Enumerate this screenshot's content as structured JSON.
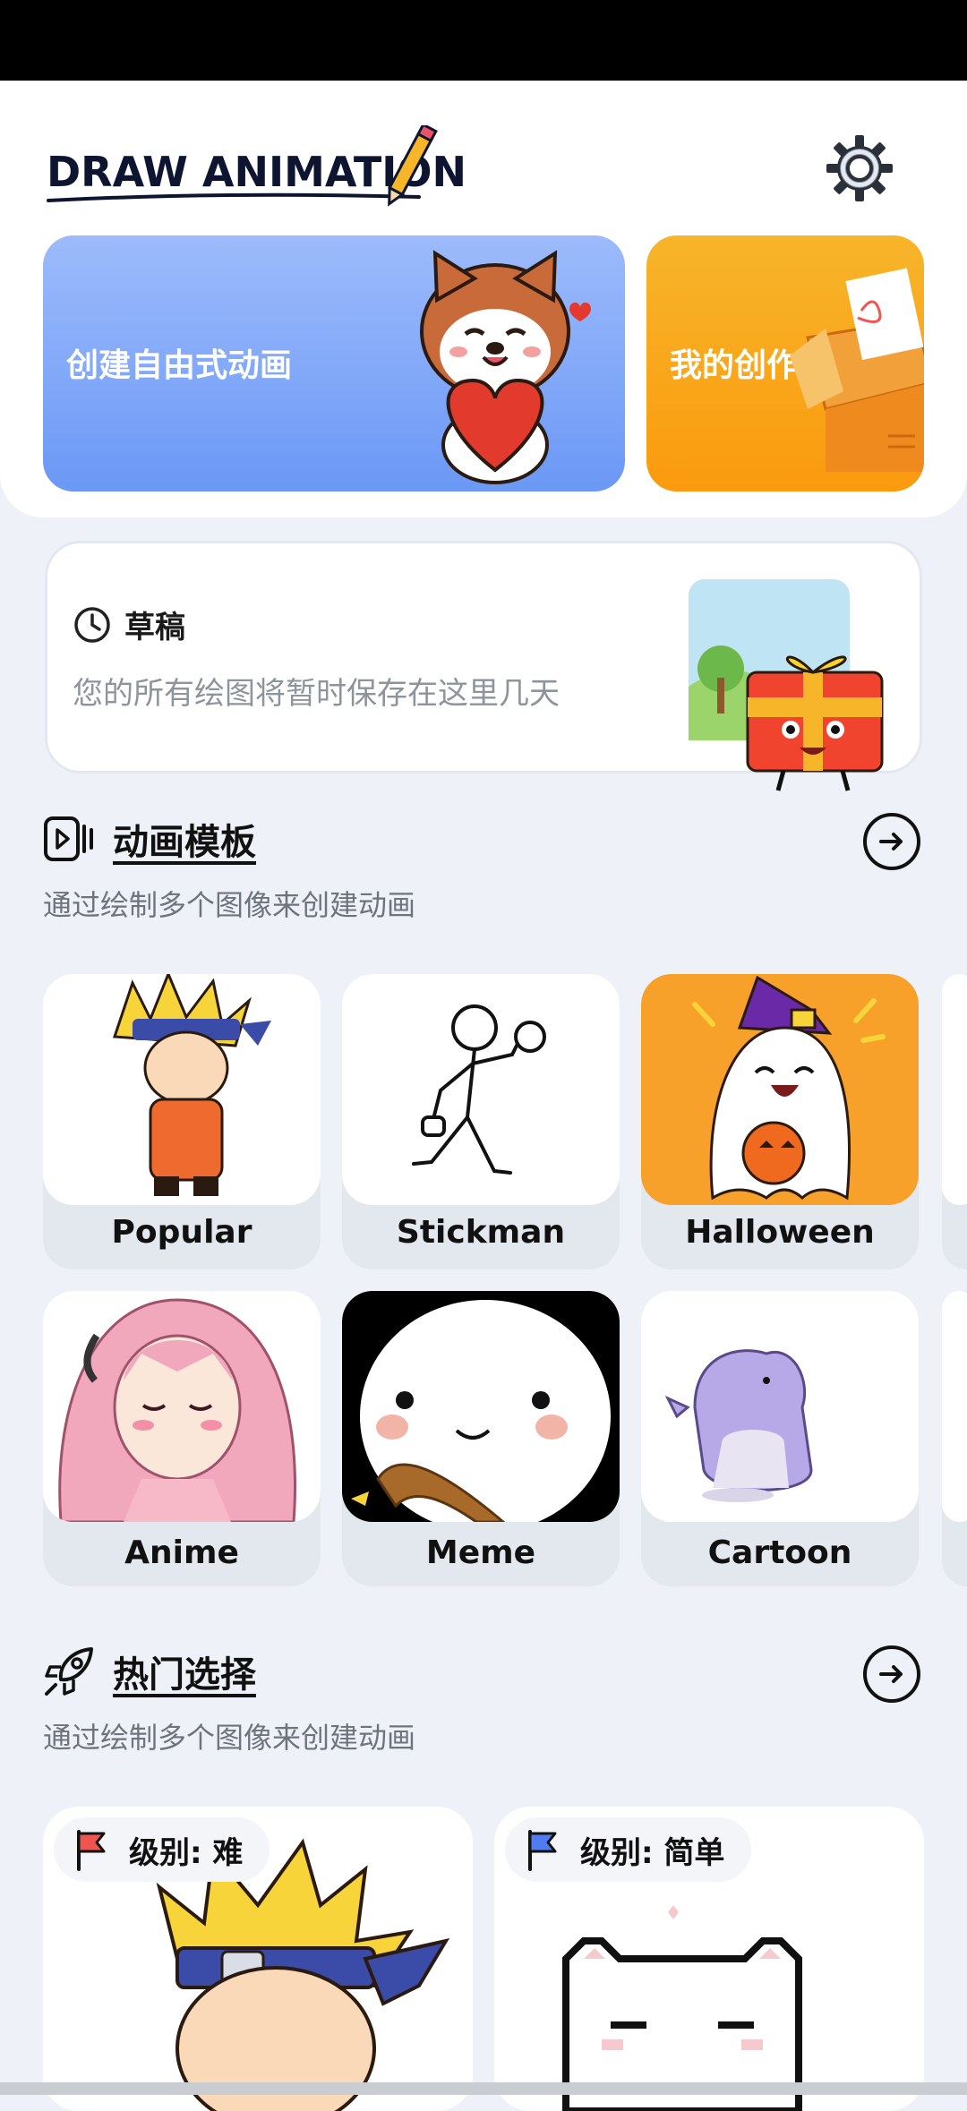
{
  "app": {
    "logo_text": "DRAW ANIMATION"
  },
  "top_cards": {
    "create_label": "创建自由式动画",
    "mine_label": "我的创作"
  },
  "draft": {
    "title": "草稿",
    "description": "您的所有绘图将暂时保存在这里几天"
  },
  "templates_section": {
    "title": "动画模板",
    "subtitle": "通过绘制多个图像来创建动画",
    "items": [
      {
        "label": "Popular"
      },
      {
        "label": "Stickman"
      },
      {
        "label": "Halloween"
      },
      {
        "label": "Anime"
      },
      {
        "label": "Meme"
      },
      {
        "label": "Cartoon"
      }
    ]
  },
  "hot_section": {
    "title": "热门选择",
    "subtitle": "通过绘制多个图像来创建动画",
    "items": [
      {
        "level": "级别: 难",
        "flag_color": "#F0544F"
      },
      {
        "level": "级别: 简单",
        "flag_color": "#4F7CF0"
      }
    ]
  },
  "colors": {
    "create_card": "#7FA6F8",
    "mine_card": "#F9A81B",
    "halloween_bg": "#F7A02A",
    "background": "#EEF2F8"
  }
}
